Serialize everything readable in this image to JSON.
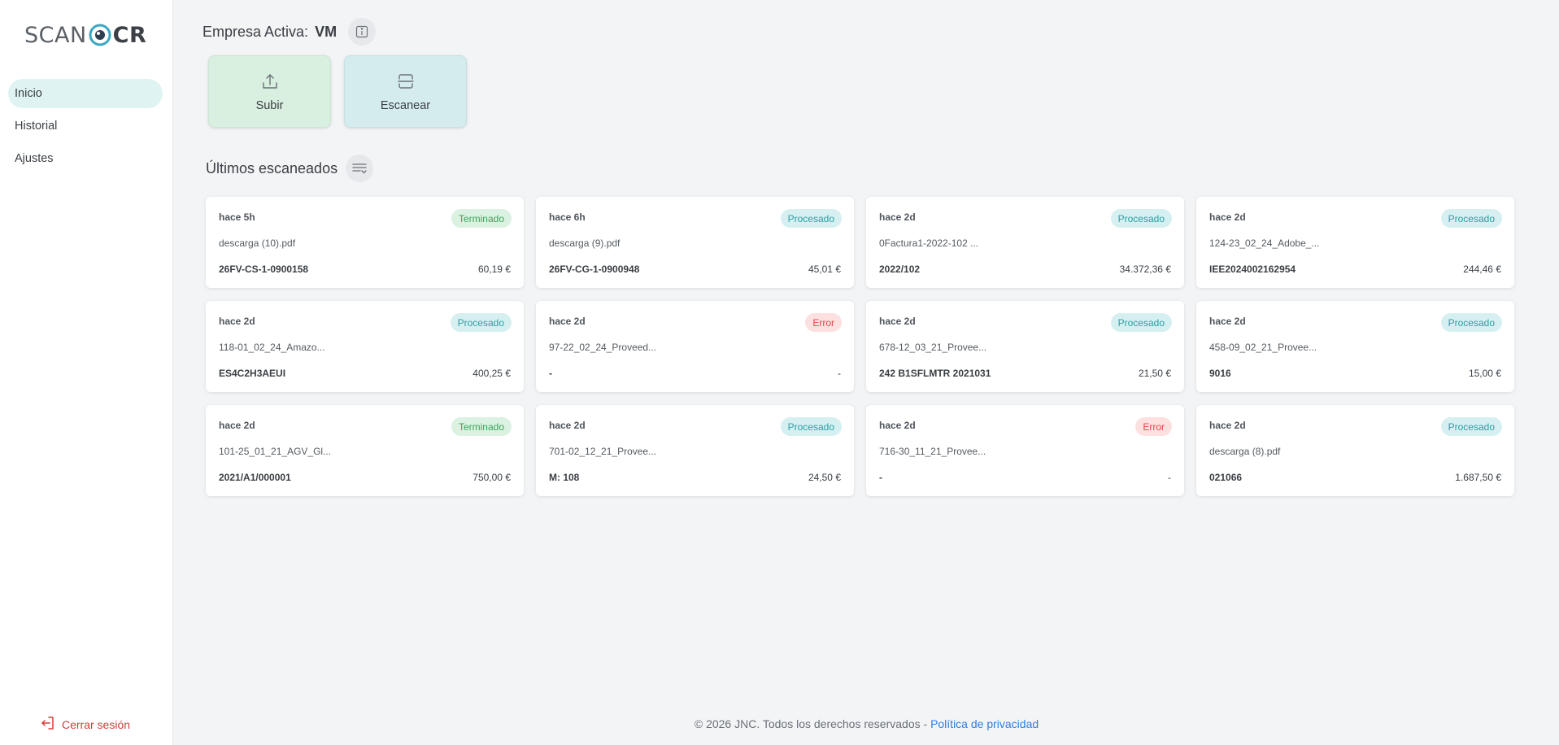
{
  "logo": {
    "part1": "SCAN",
    "part2": "CR"
  },
  "nav": {
    "items": [
      {
        "label": "Inicio",
        "active": true
      },
      {
        "label": "Historial",
        "active": false
      },
      {
        "label": "Ajustes",
        "active": false
      }
    ],
    "logout": "Cerrar sesión"
  },
  "header": {
    "company_label": "Empresa Activa:",
    "company_value": "VM"
  },
  "actions": {
    "upload": "Subir",
    "scan": "Escanear"
  },
  "section": {
    "title": "Últimos escaneados"
  },
  "cards": [
    {
      "time": "hace 5h",
      "status": "Terminado",
      "status_type": "terminado",
      "file": "descarga (10).pdf",
      "code": "26FV-CS-1-0900158",
      "amount": "60,19 €"
    },
    {
      "time": "hace 6h",
      "status": "Procesado",
      "status_type": "procesado",
      "file": "descarga (9).pdf",
      "code": "26FV-CG-1-0900948",
      "amount": "45,01 €"
    },
    {
      "time": "hace 2d",
      "status": "Procesado",
      "status_type": "procesado",
      "file": "0Factura1-2022-102 ...",
      "code": "2022/102",
      "amount": "34.372,36 €"
    },
    {
      "time": "hace 2d",
      "status": "Procesado",
      "status_type": "procesado",
      "file": "124-23_02_24_Adobe_...",
      "code": "IEE2024002162954",
      "amount": "244,46 €"
    },
    {
      "time": "hace 2d",
      "status": "Procesado",
      "status_type": "procesado",
      "file": "118-01_02_24_Amazo...",
      "code": "ES4C2H3AEUI",
      "amount": "400,25 €"
    },
    {
      "time": "hace 2d",
      "status": "Error",
      "status_type": "error",
      "file": "97-22_02_24_Proveed...",
      "code": "-",
      "amount": "-"
    },
    {
      "time": "hace 2d",
      "status": "Procesado",
      "status_type": "procesado",
      "file": "678-12_03_21_Provee...",
      "code": "242 B1SFLMTR 2021031",
      "amount": "21,50 €"
    },
    {
      "time": "hace 2d",
      "status": "Procesado",
      "status_type": "procesado",
      "file": "458-09_02_21_Provee...",
      "code": "9016",
      "amount": "15,00 €"
    },
    {
      "time": "hace 2d",
      "status": "Terminado",
      "status_type": "terminado",
      "file": "101-25_01_21_AGV_Gl...",
      "code": "2021/A1/000001",
      "amount": "750,00 €"
    },
    {
      "time": "hace 2d",
      "status": "Procesado",
      "status_type": "procesado",
      "file": "701-02_12_21_Provee...",
      "code": "M: 108",
      "amount": "24,50 €"
    },
    {
      "time": "hace 2d",
      "status": "Error",
      "status_type": "error",
      "file": "716-30_11_21_Provee...",
      "code": "-",
      "amount": "-"
    },
    {
      "time": "hace 2d",
      "status": "Procesado",
      "status_type": "procesado",
      "file": "descarga (8).pdf",
      "code": "021066",
      "amount": "1.687,50 €"
    }
  ],
  "footer": {
    "copyright": "© 2026 JNC. Todos los derechos reservados - ",
    "privacy": "Política de privacidad"
  },
  "colors": {
    "accent": "#2a9ea3",
    "error": "#e04848",
    "success": "#3aa45b",
    "link": "#2f7ee0"
  }
}
